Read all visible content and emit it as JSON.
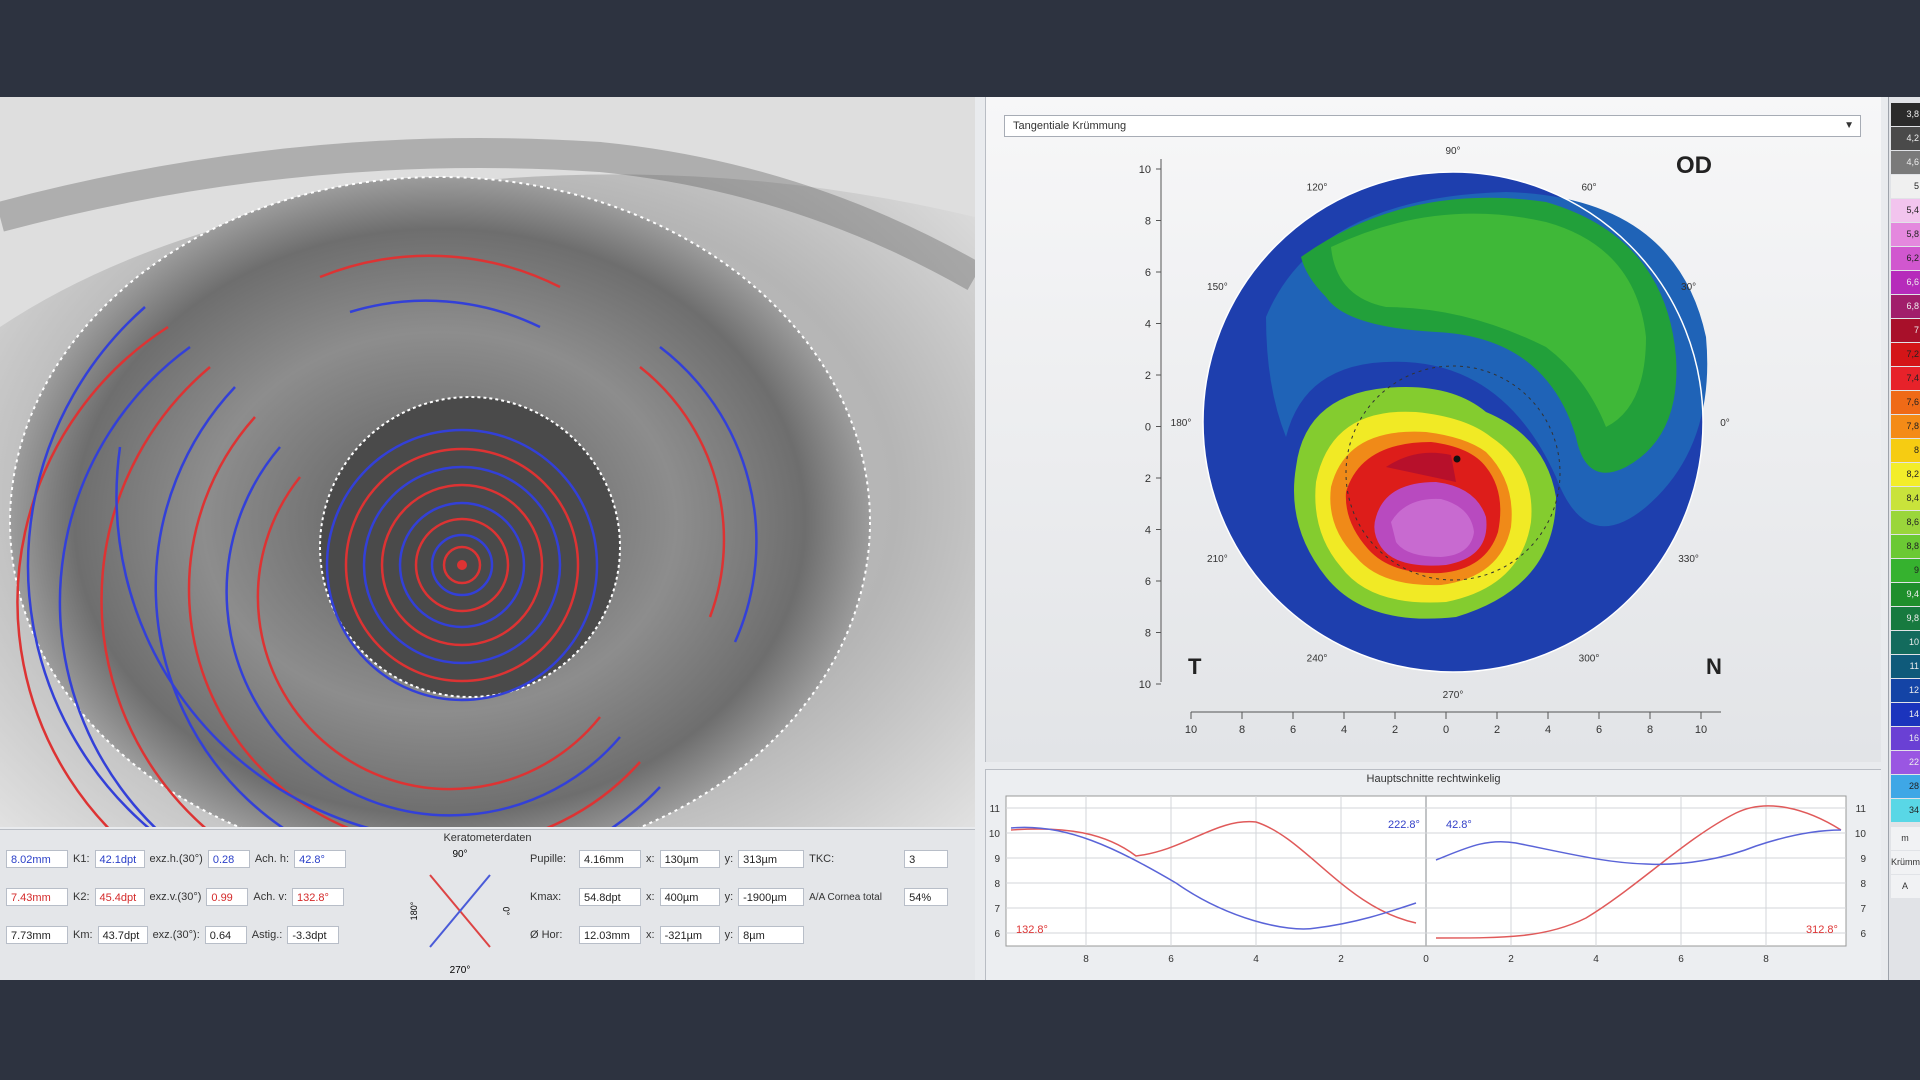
{
  "map": {
    "dropdown_value": "Tangentiale Krümmung",
    "eye_label": "OD",
    "side_left": "T",
    "side_right": "N",
    "angle_labels": [
      "90°",
      "60°",
      "30°",
      "0°",
      "330°",
      "300°",
      "270°",
      "240°",
      "210°",
      "180°",
      "150°",
      "120°"
    ],
    "axis_ticks": [
      "10",
      "8",
      "6",
      "4",
      "2",
      "0",
      "2",
      "4",
      "6",
      "8",
      "10"
    ]
  },
  "kerato": {
    "title": "Keratometerdaten",
    "rows": [
      {
        "radius": "8.02mm",
        "k_label": "K1:",
        "k_value": "42.1dpt",
        "exz_label": "exz.h.(30°)",
        "exz_value": "0.28",
        "ach_label": "Ach. h:",
        "ach_value": "42.8°"
      },
      {
        "radius": "7.43mm",
        "k_label": "K2:",
        "k_value": "45.4dpt",
        "exz_label": "exz.v.(30°)",
        "exz_value": "0.99",
        "ach_label": "Ach. v:",
        "ach_value": "132.8°"
      },
      {
        "radius": "7.73mm",
        "k_label": "Km:",
        "k_value": "43.7dpt",
        "exz_label": "exz.(30°):",
        "exz_value": "0.64",
        "ach_label": "Astig.:",
        "ach_value": "-3.3dpt"
      }
    ],
    "cross": {
      "top": "90°",
      "bottom": "270°",
      "left": "180°",
      "right": "0°"
    },
    "right_rows": [
      {
        "label": "Pupille:",
        "v1": "4.16mm",
        "xl": "x:",
        "x": "130µm",
        "yl": "y:",
        "y": "313µm",
        "extra_label": "TKC:",
        "extra_value": "3"
      },
      {
        "label": "Kmax:",
        "v1": "54.8dpt",
        "xl": "x:",
        "x": "400µm",
        "yl": "y:",
        "y": "-1900µm",
        "extra_label": "A/A Cornea total",
        "extra_value": "54%"
      },
      {
        "label": "Ø Hor:",
        "v1": "12.03mm",
        "xl": "x:",
        "x": "-321µm",
        "yl": "y:",
        "y": "8µm",
        "extra_label": "",
        "extra_value": ""
      }
    ]
  },
  "profiles": {
    "title": "Hauptschnitte rechtwinkelig",
    "left_labels": {
      "blue": "222.8°",
      "red": "132.8°"
    },
    "right_labels": {
      "blue": "42.8°",
      "red": "312.8°"
    },
    "y_ticks": [
      "11",
      "10",
      "9",
      "8",
      "7",
      "6"
    ],
    "x_ticks": [
      "8",
      "6",
      "4",
      "2",
      "0",
      "2",
      "4",
      "6",
      "8"
    ]
  },
  "scale": {
    "values": [
      "3,8",
      "4,2",
      "4,6",
      "5",
      "5,4",
      "5,8",
      "6,2",
      "6,6",
      "6,8",
      "7",
      "7,2",
      "7,4",
      "7,6",
      "7,8",
      "8",
      "8,2",
      "8,4",
      "8,6",
      "8,8",
      "9",
      "9,4",
      "9,8",
      "10",
      "11",
      "12",
      "14",
      "16",
      "22",
      "28",
      "34"
    ],
    "colors": [
      "#2b2b2b",
      "#4a4a4a",
      "#7a7a7a",
      "#f0f0f0",
      "#f2c4ee",
      "#e488de",
      "#d157cf",
      "#b62bbb",
      "#a11e6b",
      "#a8102a",
      "#d41518",
      "#e7222a",
      "#ef6a17",
      "#f48b17",
      "#f6cc12",
      "#f3ed2a",
      "#c9e33b",
      "#9ad63b",
      "#6bc934",
      "#36b22f",
      "#1f8f2c",
      "#177a3f",
      "#136b5d",
      "#0f5a7a",
      "#1444a6",
      "#1b34bd",
      "#6a40d4",
      "#9a56e2",
      "#3ea7e6",
      "#59d7e6"
    ],
    "footer": [
      "m",
      "Krümm",
      "A"
    ]
  }
}
